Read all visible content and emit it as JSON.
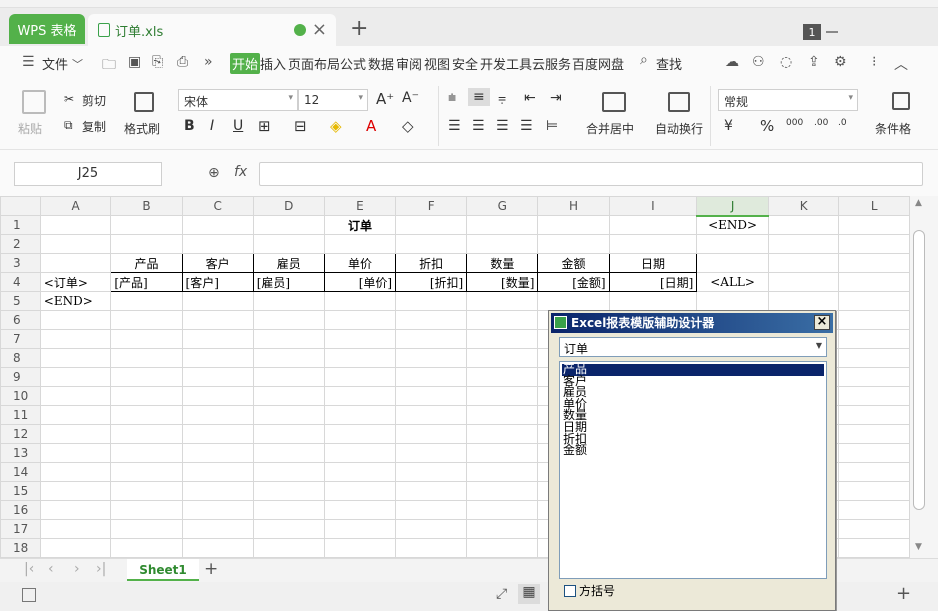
{
  "titlebar": {
    "app_tab": "WPS 表格",
    "doc_tab": "订单.xls",
    "window_count": "1"
  },
  "menu": {
    "file": "文件",
    "tabs": [
      "开始",
      "插入",
      "页面布局",
      "公式",
      "数据",
      "审阅",
      "视图",
      "安全",
      "开发工具",
      "云服务",
      "百度网盘"
    ],
    "search": "查找"
  },
  "ribbon": {
    "paste": "粘贴",
    "cut": "剪切",
    "copy": "复制",
    "format_painter": "格式刷",
    "font_name": "宋体",
    "font_size": "12",
    "merge_center": "合并居中",
    "wrap_text": "自动换行",
    "number_format": "常规",
    "conditional": "条件格"
  },
  "formula_bar": {
    "cell_ref": "J25",
    "fx_label": "fx",
    "content": ""
  },
  "sheet": {
    "columns": [
      "A",
      "B",
      "C",
      "D",
      "E",
      "F",
      "G",
      "H",
      "I",
      "J",
      "K",
      "L"
    ],
    "rows": [
      [
        "",
        "",
        "",
        "",
        "订单",
        "",
        "",
        "",
        "",
        "<END>",
        "",
        ""
      ],
      [
        "",
        "",
        "",
        "",
        "",
        "",
        "",
        "",
        "",
        "",
        "",
        ""
      ],
      [
        "",
        "产品",
        "客户",
        "雇员",
        "单价",
        "折扣",
        "数量",
        "金额",
        "日期",
        "",
        "",
        ""
      ],
      [
        "<订单>",
        "[产品]",
        "[客户]",
        "[雇员]",
        "[单价]",
        "[折扣]",
        "[数量]",
        "[金额]",
        "[日期]",
        "<ALL>",
        "",
        ""
      ],
      [
        "<END>",
        "",
        "",
        "",
        "",
        "",
        "",
        "",
        "",
        "",
        "",
        ""
      ],
      [
        "",
        "",
        "",
        "",
        "",
        "",
        "",
        "",
        "",
        "",
        "",
        ""
      ],
      [
        "",
        "",
        "",
        "",
        "",
        "",
        "",
        "",
        "",
        "",
        "",
        ""
      ],
      [
        "",
        "",
        "",
        "",
        "",
        "",
        "",
        "",
        "",
        "",
        "",
        ""
      ],
      [
        "",
        "",
        "",
        "",
        "",
        "",
        "",
        "",
        "",
        "",
        "",
        ""
      ],
      [
        "",
        "",
        "",
        "",
        "",
        "",
        "",
        "",
        "",
        "",
        "",
        ""
      ],
      [
        "",
        "",
        "",
        "",
        "",
        "",
        "",
        "",
        "",
        "",
        "",
        ""
      ],
      [
        "",
        "",
        "",
        "",
        "",
        "",
        "",
        "",
        "",
        "",
        "",
        ""
      ],
      [
        "",
        "",
        "",
        "",
        "",
        "",
        "",
        "",
        "",
        "",
        "",
        ""
      ],
      [
        "",
        "",
        "",
        "",
        "",
        "",
        "",
        "",
        "",
        "",
        "",
        ""
      ],
      [
        "",
        "",
        "",
        "",
        "",
        "",
        "",
        "",
        "",
        "",
        "",
        ""
      ],
      [
        "",
        "",
        "",
        "",
        "",
        "",
        "",
        "",
        "",
        "",
        "",
        ""
      ],
      [
        "",
        "",
        "",
        "",
        "",
        "",
        "",
        "",
        "",
        "",
        "",
        ""
      ],
      [
        "",
        "",
        "",
        "",
        "",
        "",
        "",
        "",
        "",
        "",
        "",
        ""
      ]
    ],
    "sheet_tab": "Sheet1"
  },
  "dialog": {
    "title": "Excel报表模版辅助设计器",
    "combo_value": "订单",
    "list_items": [
      "产品",
      "客户",
      "雇员",
      "单价",
      "数量",
      "日期",
      "折扣",
      "金额"
    ],
    "checkbox_label": "方括号"
  }
}
